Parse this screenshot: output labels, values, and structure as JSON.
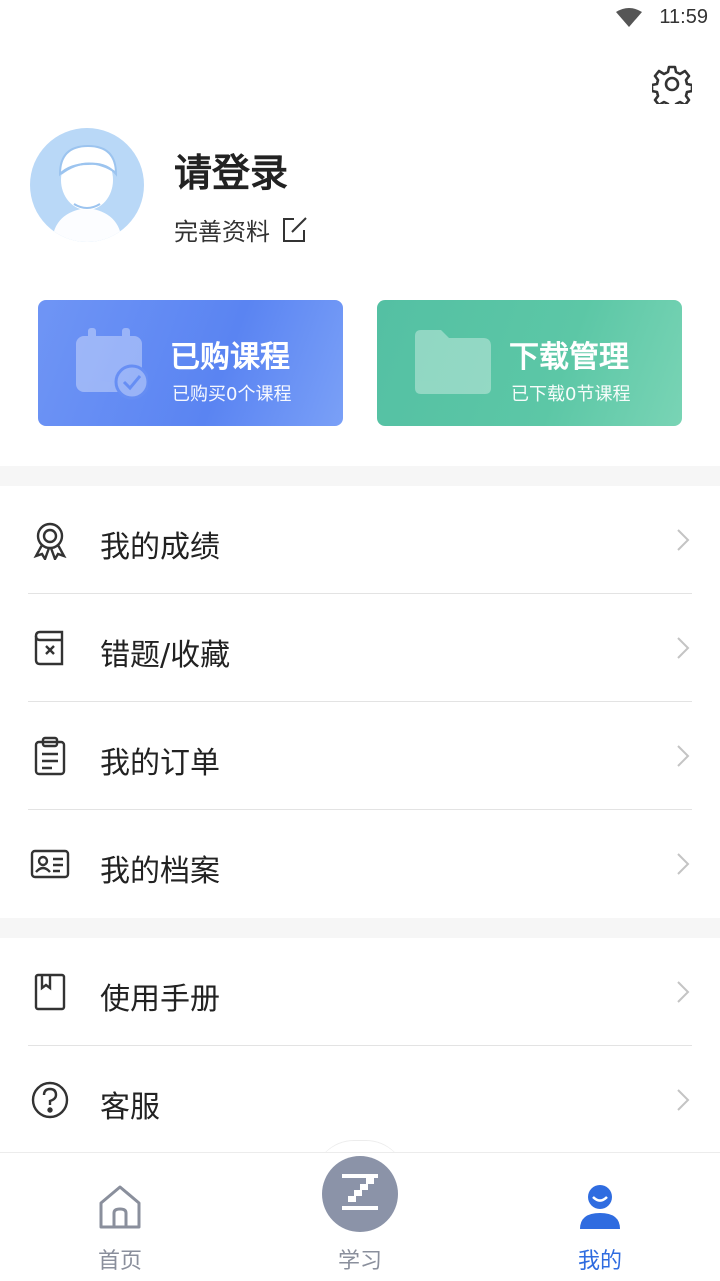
{
  "status_bar": {
    "time": "11:59"
  },
  "profile": {
    "title": "请登录",
    "complete_label": "完善资料"
  },
  "cards": [
    {
      "title": "已购课程",
      "subtitle": "已购买0个课程",
      "color": "#5a84f2"
    },
    {
      "title": "下载管理",
      "subtitle": "已下载0节课程",
      "color": "#5cc7a6"
    }
  ],
  "menu_group_1": [
    {
      "label": "我的成绩",
      "icon": "medal-icon"
    },
    {
      "label": "错题/收藏",
      "icon": "wrong-book-icon"
    },
    {
      "label": "我的订单",
      "icon": "clipboard-icon"
    },
    {
      "label": "我的档案",
      "icon": "id-card-icon"
    }
  ],
  "menu_group_2": [
    {
      "label": "使用手册",
      "icon": "bookmark-book-icon"
    },
    {
      "label": "客服",
      "icon": "question-icon"
    }
  ],
  "tabbar": {
    "home": "首页",
    "study": "学习",
    "mine": "我的",
    "active_color": "#2f6ce0",
    "inactive_color": "#8a8f9c"
  }
}
